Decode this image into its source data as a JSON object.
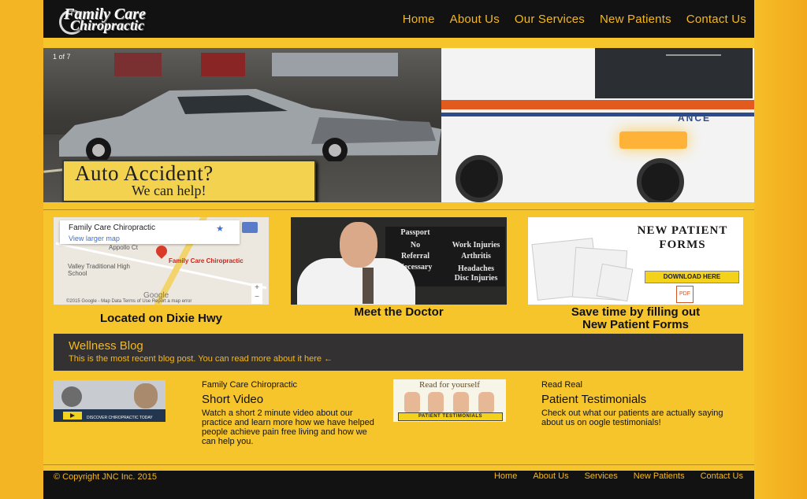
{
  "brand": {
    "logo_line1": "Family Care",
    "logo_line2": "Chiropractic"
  },
  "nav": [
    "Home",
    "About Us",
    "Our Services",
    "New Patients",
    "Contact Us"
  ],
  "hero": {
    "slide_counter": "1 of 7",
    "banner_line1": "Auto Accident?",
    "banner_line2": "We can help!",
    "ambulance_text": "ANCE"
  },
  "tiles": {
    "map": {
      "card_title": "Family Care Chiropractic",
      "card_link": "View larger map",
      "pin_label": "Family Care Chiropractic",
      "street1": "Appollo Ct",
      "school": "Valley Traditional High School",
      "google": "Google",
      "footer": "©2015 Google - Map Data   Terms of Use   Report a map error",
      "caption": "Located on Dixie Hwy"
    },
    "doctor": {
      "sign_lines": [
        "Passport",
        "No",
        "Referral",
        "Necessary",
        "Work Injuries",
        "Arthritis",
        "Headaches",
        "Disc Injuries"
      ],
      "caption": "Meet the Doctor"
    },
    "forms": {
      "title": "NEW PATIENT FORMS",
      "download": "DOWNLOAD HERE",
      "pdf": "PDF",
      "caption_line1": "Save time by filling out",
      "caption_line2": "New Patient Forms"
    }
  },
  "blog": {
    "title": "Wellness Blog",
    "text": "This is the most recent blog post. You can read more about it here ←"
  },
  "video": {
    "thumb_caption": "DISCOVER CHIROPRACTIC TODAY",
    "small": "Family Care Chiropractic",
    "head": "Short Video",
    "body": "Watch a short 2 minute video about our practice and learn more how we have helped people achieve pain free living and how we can help you."
  },
  "testimonials": {
    "thumb_title": "Read for yourself",
    "thumb_strip": "PATIENT TESTIMONIALS",
    "small": "Read Real",
    "head": "Patient Testimonials",
    "body": "Check out what our patients are actually saying about us on oogle testimonials!"
  },
  "footer": {
    "copyright": "© Copyright JNC Inc. 2015",
    "links": [
      "Home",
      "About Us",
      "Services",
      "New Patients",
      "Contact Us"
    ]
  }
}
